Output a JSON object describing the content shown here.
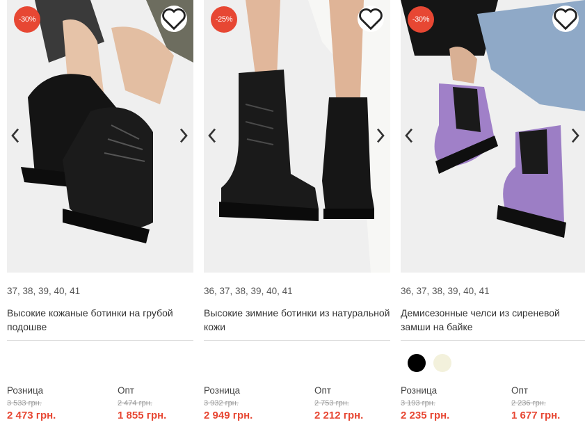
{
  "colors": {
    "accent": "#e74733",
    "divider": "#dcdcdc"
  },
  "icons": {
    "favorite": "heart-outline-icon",
    "prev": "chevron-left-icon",
    "next": "chevron-right-icon"
  },
  "products": [
    {
      "discount": "-30%",
      "sizes": "37, 38, 39, 40, 41",
      "title": "Высокие кожаные ботинки на грубой подошве",
      "retail_label": "Розница",
      "retail_old": "3 533 грн.",
      "retail_new": "2 473 грн.",
      "wholesale_label": "Опт",
      "wholesale_old": "2 474 грн.",
      "wholesale_new": "1 855 грн.",
      "swatches": []
    },
    {
      "discount": "-25%",
      "sizes": "36, 37, 38, 39, 40, 41",
      "title": "Высокие зимние ботинки из натуральной кожи",
      "retail_label": "Розница",
      "retail_old": "3 932 грн.",
      "retail_new": "2 949 грн.",
      "wholesale_label": "Опт",
      "wholesale_old": "2 753 грн.",
      "wholesale_new": "2 212 грн.",
      "swatches": []
    },
    {
      "discount": "-30%",
      "sizes": "36, 37, 38, 39, 40, 41",
      "title": "Демисезонные челси из сиреневой замши на байке",
      "retail_label": "Розница",
      "retail_old": "3 193 грн.",
      "retail_new": "2 235 грн.",
      "wholesale_label": "Опт",
      "wholesale_old": "2 236 грн.",
      "wholesale_new": "1 677 грн.",
      "swatches": [
        "#000000",
        "#f3f1dc"
      ]
    }
  ]
}
